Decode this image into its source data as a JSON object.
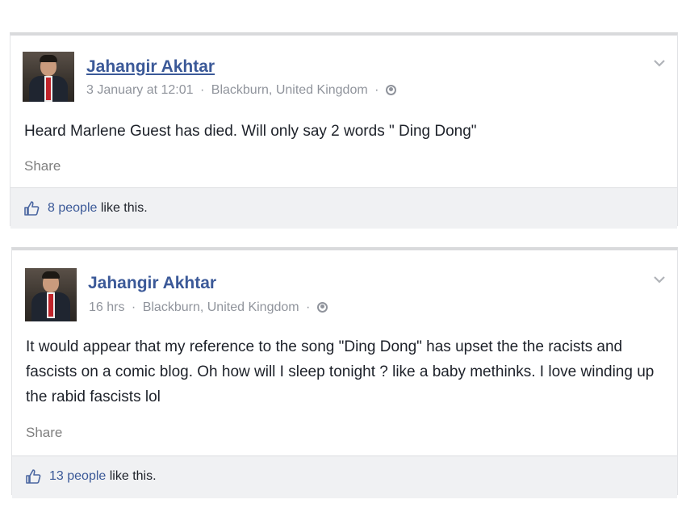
{
  "posts": [
    {
      "author": "Jahangir Akhtar",
      "time": "3 January at 12:01",
      "location": "Blackburn, United Kingdom",
      "separator": "·",
      "text": "Heard Marlene Guest has died. Will only say 2 words \" Ding Dong\"",
      "share_label": "Share",
      "likes_count": "8 people",
      "likes_suffix": " like this.",
      "privacy_icon": "globe-icon",
      "menu_icon": "chevron-down-icon"
    },
    {
      "author": "Jahangir Akhtar",
      "time": "16 hrs",
      "location": "Blackburn, United Kingdom",
      "separator": "·",
      "text": "It would appear that my reference to the song \"Ding Dong\" has upset the the racists and fascists on a comic blog. Oh how will I sleep tonight ? like a baby methinks. I love winding up the rabid fascists lol",
      "share_label": "Share",
      "likes_count": "13 people",
      "likes_suffix": " like this.",
      "privacy_icon": "globe-icon",
      "menu_icon": "chevron-down-icon"
    }
  ],
  "colors": {
    "link": "#3b5998",
    "meta": "#90949c",
    "text": "#1d2129",
    "likes_bg": "#f0f1f3"
  }
}
